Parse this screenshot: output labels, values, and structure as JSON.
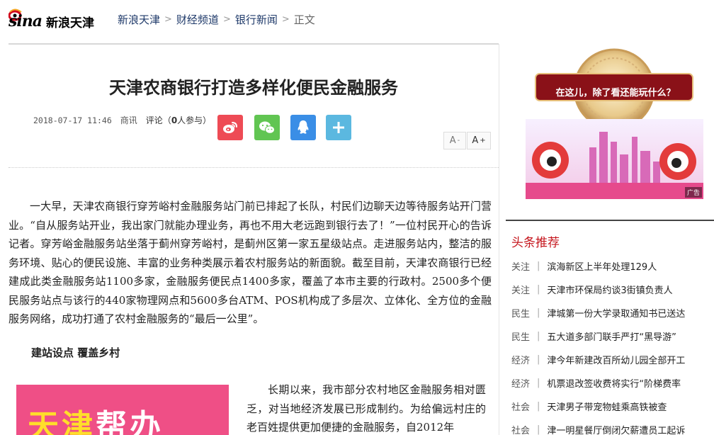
{
  "header": {
    "logo_brand": "sina",
    "logo_name": "新浪天津",
    "breadcrumb": [
      "新浪天津",
      "财经频道",
      "银行新闻"
    ],
    "breadcrumb_current": "正文",
    "separator": ">"
  },
  "article": {
    "title": "天津农商银行打造多样化便民金融服务",
    "date": "2018-07-17 11:46",
    "source": "商讯",
    "comments_prefix": "评论（",
    "comments_count": "0",
    "comments_suffix": "人参与）",
    "font_small": "A",
    "font_small_sup": "-",
    "font_large": "A",
    "font_large_sup": "+",
    "paragraph_1": "一大早，天津农商银行穿芳峪村金融服务站门前已排起了长队，村民们边聊天边等待服务站开门营业。“自从服务站开业，我出家门就能办理业务，再也不用大老远跑到银行去了！”一位村民开心的告诉记者。穿芳峪金融服务站坐落于蓟州穿芳峪村，是蓟州区第一家五星级站点。走进服务站内，整洁的服务环境、贴心的便民设施、丰富的业务种类展示着农村服务站的新面貌。截至目前，天津农商银行已经建成此类金融服务站1100多家，金融服务便民点1400多家，覆盖了本市主要的行政村。2500多个便民服务站点与该行的440家物理网点和5600多台ATM、POS机构成了多层次、立体化、全方位的金融服务网络，成功打通了农村金融服务的“最后一公里”。",
    "subhead": "建站设点 覆盖乡村",
    "promo_text_a": "天津",
    "promo_text_b": "帮办",
    "paragraph_2": "长期以来，我市部分农村地区金融服务相对匮乏，对当地经济发展已形成制约。为给偏远村庄的老百姓提供更加便捷的金融服务，自2012年"
  },
  "ad": {
    "banner_text": "在这儿，除了看还能玩什么？",
    "label": "广告"
  },
  "sidebar": {
    "title": "头条推荐",
    "items": [
      {
        "cat": "关注",
        "headline": "滨海新区上半年处理129人"
      },
      {
        "cat": "关注",
        "headline": "天津市环保局约谈3街镇负责人"
      },
      {
        "cat": "民生",
        "headline": "津城第一份大学录取通知书已送达"
      },
      {
        "cat": "民生",
        "headline": "五大道多部门联手严打“黑导游”"
      },
      {
        "cat": "经济",
        "headline": "津今年新建改百所幼儿园全部开工"
      },
      {
        "cat": "经济",
        "headline": "机票退改签收费将实行“阶梯费率"
      },
      {
        "cat": "社会",
        "headline": "天津男子带宠物蛙乘高铁被查"
      },
      {
        "cat": "社会",
        "headline": "津一明星餐厅倒闭欠薪遭员工起诉"
      }
    ]
  },
  "colors": {
    "accent_red": "#c5161d",
    "weibo": "#ee4b55",
    "wechat": "#61c552",
    "qq": "#3a8ee6",
    "more": "#5bb8e0",
    "promo_bg": "#ef4f86"
  },
  "icons": [
    "sina-eye-icon",
    "weibo-icon",
    "wechat-icon",
    "qq-icon",
    "plus-icon"
  ]
}
